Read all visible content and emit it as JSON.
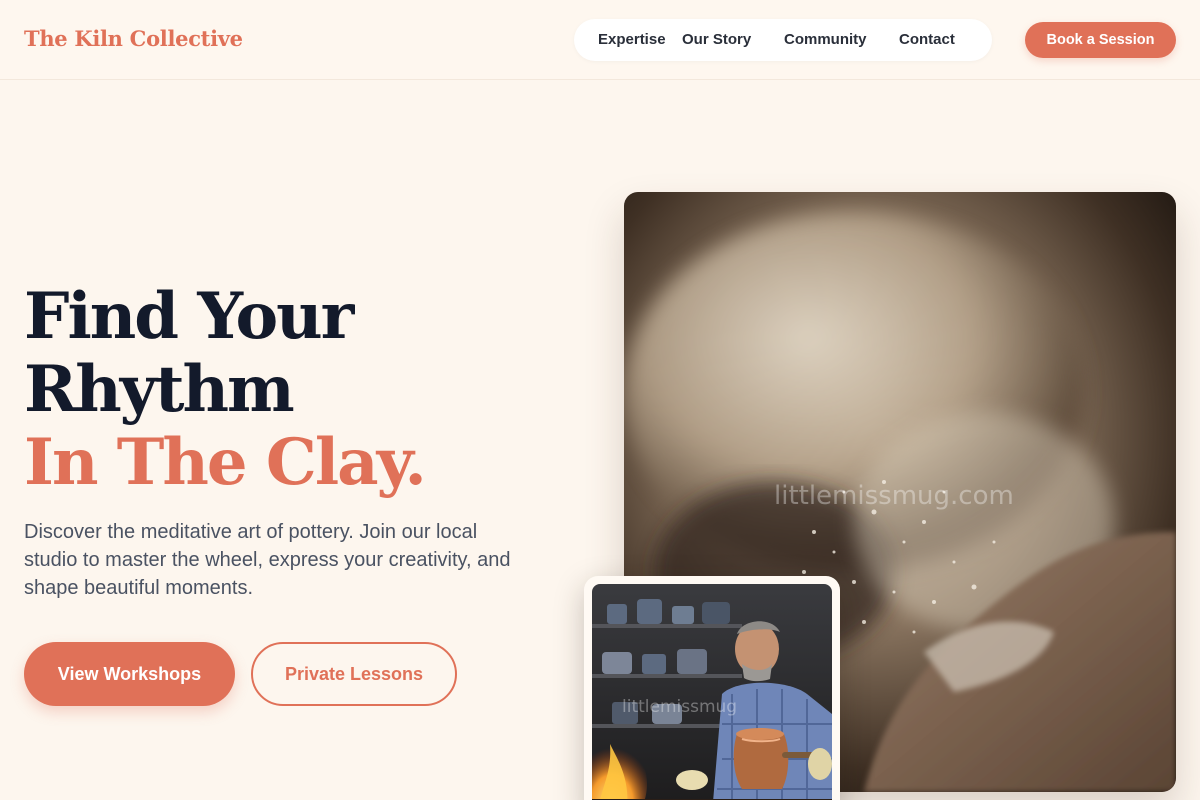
{
  "header": {
    "brand": "The Kiln Collective",
    "nav": [
      {
        "label": "Expertise"
      },
      {
        "label": "Our Story"
      },
      {
        "label": "Community"
      },
      {
        "label": "Contact"
      }
    ],
    "cta_label": "Book a Session"
  },
  "hero": {
    "headline_line1": "Find Your",
    "headline_line2": "Rhythm",
    "headline_accent": "In The Clay.",
    "subtext": "Discover the meditative art of pottery. Join our local studio to master the wheel, express your creativity, and shape beautiful moments.",
    "primary_button": "View Workshops",
    "secondary_button": "Private Lessons"
  },
  "images": {
    "main_watermark": "littlemissmug.com",
    "small_watermark": "littlemissmug"
  },
  "colors": {
    "accent": "#e07158",
    "background": "#fdf6ee",
    "heading": "#131a2b"
  }
}
